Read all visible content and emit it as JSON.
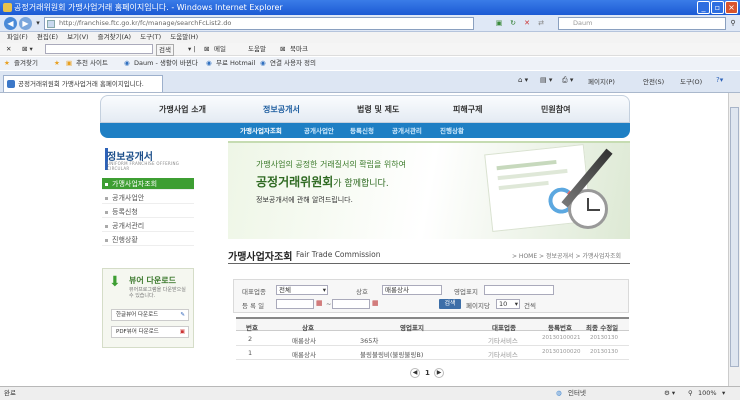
{
  "window": {
    "title": "공정거래위원회 가맹사업거래 홈페이지입니다. - Windows Internet Explorer"
  },
  "address": {
    "url": "http://franchise.ftc.go.kr/fc/manage/searchFcList2.do",
    "search_placeholder": "Daum"
  },
  "menubar": [
    "파일(F)",
    "편집(E)",
    "보기(V)",
    "즐겨찾기(A)",
    "도구(T)",
    "도움말(H)"
  ],
  "toolbar": {
    "search_button": "검색",
    "mail": "메일",
    "help": "도움말",
    "bookmark": "북마크"
  },
  "favorites": {
    "label": "즐겨찾기",
    "items": [
      "추천 사이트",
      "Daum - 생활이 바뀐다",
      "무료 Hotmail",
      "연결 사용자 정의"
    ]
  },
  "tab": {
    "label": "공정거래위원회 가맹사업거래 홈페이지입니다."
  },
  "ie_commands": {
    "page": "페이지(P)",
    "safety": "안전(S)",
    "tools": "도구(O)"
  },
  "nav": {
    "main": [
      "가맹사업 소개",
      "정보공개서",
      "법령 및 제도",
      "피해구제",
      "민원참여"
    ],
    "sub": [
      "가맹사업자조회",
      "공개사업안",
      "등록신청",
      "공개서관리",
      "진행상황"
    ]
  },
  "sidebar": {
    "title": "정보공개서",
    "subtitle": "UNIFORM FRANCHISE OFFERING CIRCULAR",
    "items": [
      "가맹사업자조회",
      "공개사업안",
      "등록신청",
      "공개서관리",
      "진행상황"
    ],
    "download": {
      "title": "뷰어 다운로드",
      "desc": "뷰어프로그램을 다운받으실 수 있습니다.",
      "btn_hangul": "한글뷰어 다운로드",
      "btn_pdf": "PDF뷰어 다운로드"
    }
  },
  "banner": {
    "line1": "가맹사업의 공정한 거래질서의 확립을 위하여",
    "line2_strong": "공정거래위원회",
    "line2_rest": "가 함께합니다.",
    "line3": "정보공개서에 관해 알려드립니다."
  },
  "page_title": "가맹사업자조회",
  "page_subtitle": "Fair Trade Commission",
  "breadcrumb": "> HOME > 정보공개서 > 가맹사업자조회",
  "filter": {
    "business_label": "대표업종",
    "business_value": "전체",
    "company_label": "상호",
    "company_value": "매롱상사",
    "brand_label": "영업표지",
    "brand_value": "",
    "date_label": "등 록 일",
    "search_button": "검색",
    "per_page_label": "페이지당",
    "per_page_value": "10",
    "per_page_unit": "건씩"
  },
  "table": {
    "headers": [
      "번호",
      "상호",
      "영업표지",
      "대표업종",
      "등록번호",
      "최종 수정일"
    ],
    "rows": [
      [
        "2",
        "매롱상사",
        "365차",
        "기타서비스",
        "20130100021",
        "20130130"
      ],
      [
        "1",
        "매롱상사",
        "불링불링비(불링불링B)",
        "기타서비스",
        "20130100020",
        "20130130"
      ]
    ]
  },
  "pager": {
    "current": "1"
  },
  "status": {
    "left": "완료",
    "zone": "인터넷",
    "zoom": "100%"
  },
  "colors": {
    "accent": "#1e7fc4",
    "side_active": "#3d9e32"
  }
}
